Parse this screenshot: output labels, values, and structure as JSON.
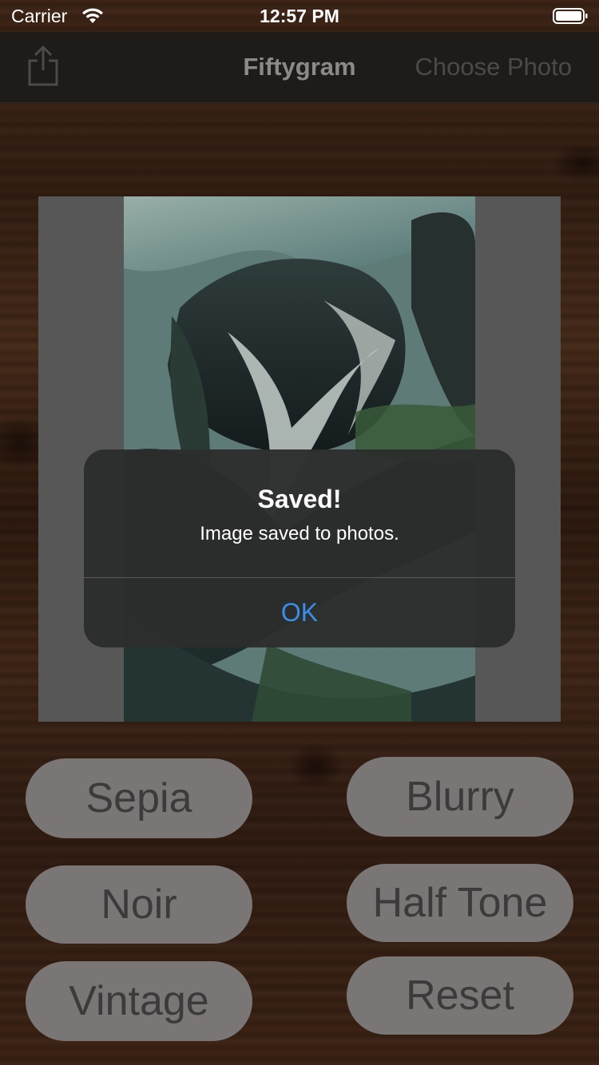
{
  "status_bar": {
    "carrier": "Carrier",
    "time": "12:57 PM"
  },
  "nav": {
    "title": "Fiftygram",
    "right_button": "Choose Photo",
    "left_icon": "share-icon"
  },
  "filters": [
    {
      "label": "Sepia"
    },
    {
      "label": "Blurry"
    },
    {
      "label": "Noir"
    },
    {
      "label": "Half Tone"
    },
    {
      "label": "Vintage"
    },
    {
      "label": "Reset"
    }
  ],
  "alert": {
    "title": "Saved!",
    "message": "Image saved to photos.",
    "ok_label": "OK"
  },
  "colors": {
    "accent": "#3a8ee8",
    "nav_background": "#1f1b19",
    "button_background": "#7a7675",
    "image_frame": "#575757"
  }
}
